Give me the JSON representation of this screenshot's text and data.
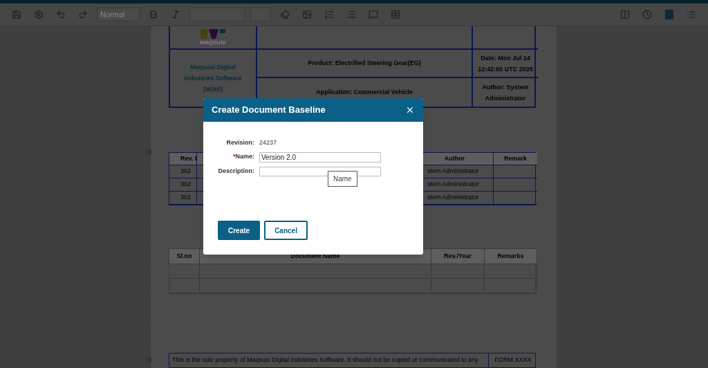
{
  "toolbar": {
    "style_select": "Normal"
  },
  "header_table": {
    "logo_text": "MAQSUSI",
    "company": "Maqsusi Digital Industries Software (MDIS)",
    "product": "Product: Electrified Steering Gear(EG)",
    "date": "Date: Mon Jul 14 12:42:00 UTC 2025",
    "application": "Application: Commercial Vehicle",
    "author": "Author: System Administrator"
  },
  "revision_table": {
    "columns": [
      "Rev. I",
      "Author",
      "Remark"
    ],
    "rows": [
      [
        "362",
        "stem Administrator",
        ""
      ],
      [
        "362",
        "stem Administrator",
        ""
      ],
      [
        "362",
        "stem Administrator",
        ""
      ]
    ]
  },
  "document_table": {
    "columns": [
      "Sl.no",
      "Document Name",
      "Rev./Year",
      "Remarks"
    ],
    "rows": [
      [
        "",
        "",
        "",
        ""
      ],
      [
        "",
        "",
        "",
        ""
      ]
    ]
  },
  "footer": {
    "notice": "This is the sole property of Maqsusi Digital Industries Software. It should not be copied or communicated to any",
    "form": "FORM XXXX"
  },
  "dialog": {
    "title": "Create Document Baseline",
    "revision_label": "Revision:",
    "revision": "24237",
    "required_mark": "*",
    "name_label": "Name:",
    "name_value": "Version 2.0",
    "description_label": "Description:",
    "tooltip": "Name",
    "buttons": [
      {
        "label": "Create",
        "kind": "primary"
      },
      {
        "label": "Cancel",
        "kind": "secondary"
      }
    ]
  }
}
